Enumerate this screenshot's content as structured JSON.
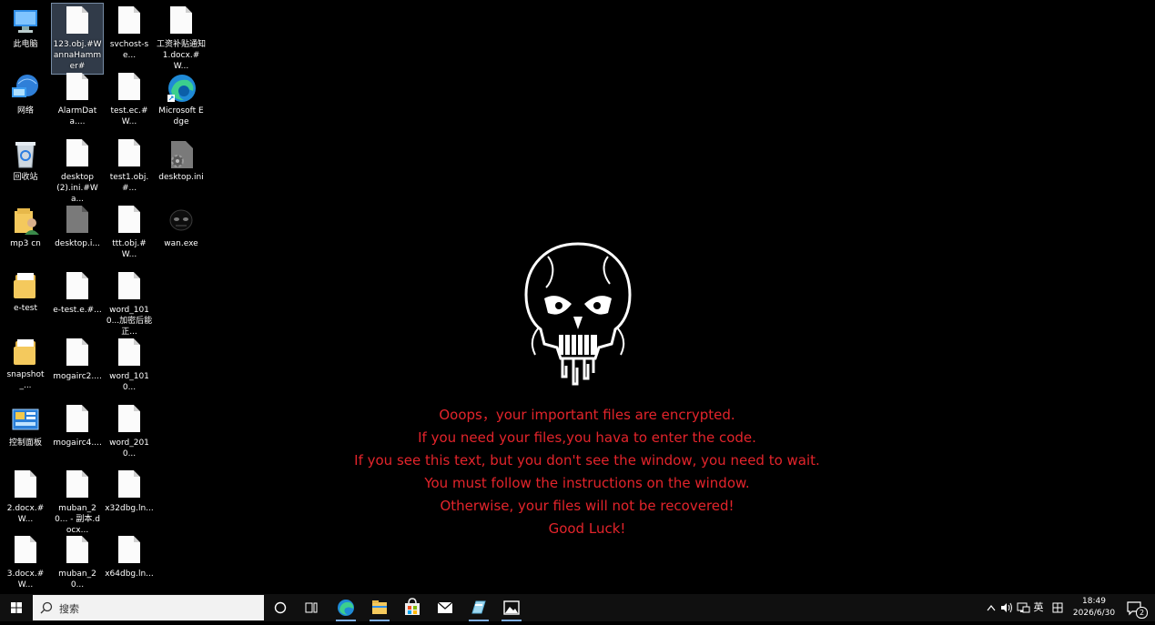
{
  "desktop": {
    "icons": [
      {
        "label": "此电脑",
        "icon": "this-pc-icon"
      },
      {
        "label": "123.obj.#WannaHammer#",
        "icon": "document-icon"
      },
      {
        "label": "svchost-se...",
        "icon": "document-icon"
      },
      {
        "label": "工资补贴通知1.docx.#W...",
        "icon": "document-icon"
      },
      {
        "label": "网络",
        "icon": "network-icon"
      },
      {
        "label": "AlarmData....",
        "icon": "document-icon"
      },
      {
        "label": "test.ec.#W...",
        "icon": "document-icon"
      },
      {
        "label": "Microsoft Edge",
        "icon": "edge-icon"
      },
      {
        "label": "回收站",
        "icon": "recycle-bin-icon"
      },
      {
        "label": "desktop (2).ini.#Wa...",
        "icon": "document-icon"
      },
      {
        "label": "test1.obj.#...",
        "icon": "document-icon"
      },
      {
        "label": "desktop.ini",
        "icon": "settings-file-icon"
      },
      {
        "label": "mp3 cn",
        "icon": "user-folder-icon"
      },
      {
        "label": "desktop.i...",
        "icon": "gray-document-icon"
      },
      {
        "label": "ttt.obj.#W...",
        "icon": "document-icon"
      },
      {
        "label": "wan.exe",
        "icon": "wan-exe-icon"
      },
      {
        "label": "e-test",
        "icon": "folder-icon"
      },
      {
        "label": "e-test.e.#...",
        "icon": "document-icon"
      },
      {
        "label": "word_1010...加密后能正...",
        "icon": "document-icon"
      },
      {
        "label": "snapshot_...",
        "icon": "folder-icon"
      },
      {
        "label": "mogairc2....",
        "icon": "document-icon"
      },
      {
        "label": "word_1010...",
        "icon": "document-icon"
      },
      {
        "label": "控制面板",
        "icon": "control-panel-icon"
      },
      {
        "label": "mogairc4....",
        "icon": "document-icon"
      },
      {
        "label": "word_2010...",
        "icon": "document-icon"
      },
      {
        "label": "2.docx.#W...",
        "icon": "document-icon"
      },
      {
        "label": "muban_20... - 副本.docx...",
        "icon": "document-icon"
      },
      {
        "label": "x32dbg.ln...",
        "icon": "document-icon"
      },
      {
        "label": "3.docx.#W...",
        "icon": "document-icon"
      },
      {
        "label": "muban_20...",
        "icon": "document-icon"
      },
      {
        "label": "x64dbg.ln...",
        "icon": "document-icon"
      }
    ]
  },
  "ransom": {
    "lines": [
      "Ooops，your important files are encrypted.",
      "If you need your files,you hava to enter the code.",
      "If you see this text, but you don't see the window, you need to wait.",
      "You must follow the instructions on the window.",
      "Otherwise, your files will not be recovered!",
      "Good Luck!"
    ],
    "color": "#e3242b"
  },
  "taskbar": {
    "search_placeholder": "搜索",
    "pinned": [
      {
        "icon": "cortana-icon"
      },
      {
        "icon": "task-view-icon"
      },
      {
        "icon": "edge-icon"
      },
      {
        "icon": "file-explorer-icon"
      },
      {
        "icon": "store-icon"
      },
      {
        "icon": "mail-icon"
      },
      {
        "icon": "app-icon"
      },
      {
        "icon": "photos-icon"
      }
    ],
    "tray": {
      "ime_label": "英",
      "time": "18:49",
      "date": "2026/6/30",
      "notification_count": "2"
    }
  }
}
